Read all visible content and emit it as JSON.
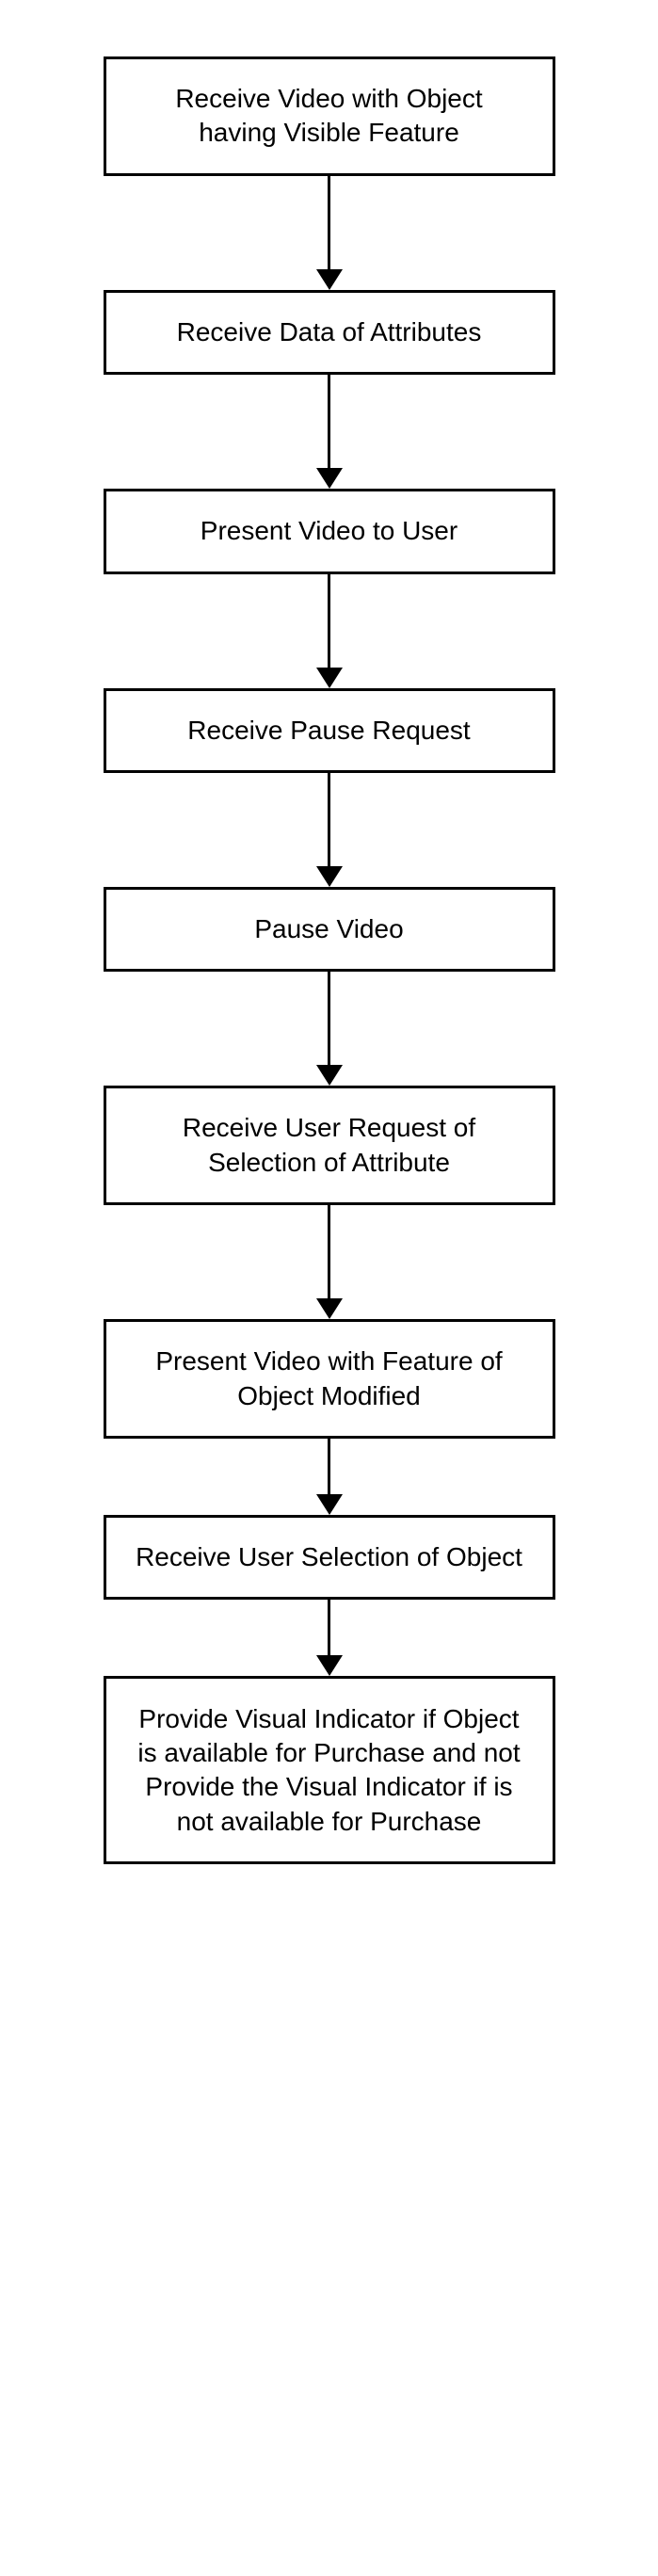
{
  "flowchart": {
    "steps": [
      {
        "label": "Receive Video with Object having Visible Feature"
      },
      {
        "label": "Receive Data of Attributes"
      },
      {
        "label": "Present Video to User"
      },
      {
        "label": "Receive Pause Request"
      },
      {
        "label": "Pause Video"
      },
      {
        "label": "Receive User Request of Selection of Attribute"
      },
      {
        "label": "Present Video with Feature of Object Modified"
      },
      {
        "label": "Receive User Selection of Object"
      },
      {
        "label": "Provide Visual Indicator if Object is available for Purchase and not Provide the Visual Indicator if is not available for Purchase"
      }
    ]
  }
}
